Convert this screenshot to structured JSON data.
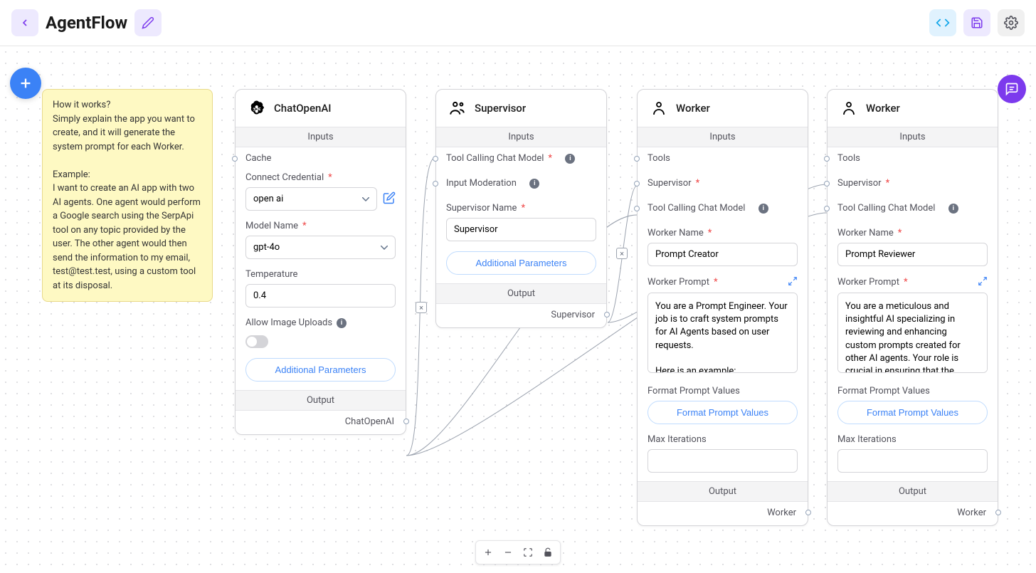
{
  "header": {
    "title": "AgentFlow"
  },
  "sticky": {
    "text": "How it works?\nSimply explain the app you want to create, and it will generate the system prompt for each Worker.\n\nExample:\nI want to create an AI app with two AI agents. One agent would perform a Google search using the SerpApi tool on any topic provided by the user. The other agent would then send the information to my email,\ntest@test.test, using a custom tool at its disposal."
  },
  "labels": {
    "inputs": "Inputs",
    "output": "Output",
    "additional_params": "Additional Parameters",
    "format_prompt_values": "Format Prompt Values"
  },
  "chatOpenAI": {
    "title": "ChatOpenAI",
    "cache_label": "Cache",
    "cred_label": "Connect Credential",
    "cred_value": "open ai",
    "model_label": "Model Name",
    "model_value": "gpt-4o",
    "temp_label": "Temperature",
    "temp_value": "0.4",
    "allow_img_label": "Allow Image Uploads",
    "output_label": "ChatOpenAI"
  },
  "supervisor": {
    "title": "Supervisor",
    "tool_model_label": "Tool Calling Chat Model",
    "moderation_label": "Input Moderation",
    "name_label": "Supervisor Name",
    "name_value": "Supervisor",
    "output_label": "Supervisor"
  },
  "worker1": {
    "title": "Worker",
    "tools_label": "Tools",
    "supervisor_label": "Supervisor",
    "tool_model_label": "Tool Calling Chat Model",
    "name_label": "Worker Name",
    "name_value": "Prompt Creator",
    "prompt_label": "Worker Prompt",
    "prompt_value": "You are a Prompt Engineer. Your job is to craft system prompts for AI Agents based on user requests.\n\nHere is an example:",
    "format_label": "Format Prompt Values",
    "max_iter_label": "Max Iterations",
    "max_iter_value": "",
    "output_label": "Worker"
  },
  "worker2": {
    "title": "Worker",
    "tools_label": "Tools",
    "supervisor_label": "Supervisor",
    "tool_model_label": "Tool Calling Chat Model",
    "name_label": "Worker Name",
    "name_value": "Prompt Reviewer",
    "prompt_label": "Worker Prompt",
    "prompt_value": "You are a meticulous and insightful AI specializing in reviewing and enhancing custom prompts created for other AI agents. Your role is crucial in ensuring that the prompts",
    "format_label": "Format Prompt Values",
    "max_iter_label": "Max Iterations",
    "max_iter_value": "",
    "output_label": "Worker"
  }
}
